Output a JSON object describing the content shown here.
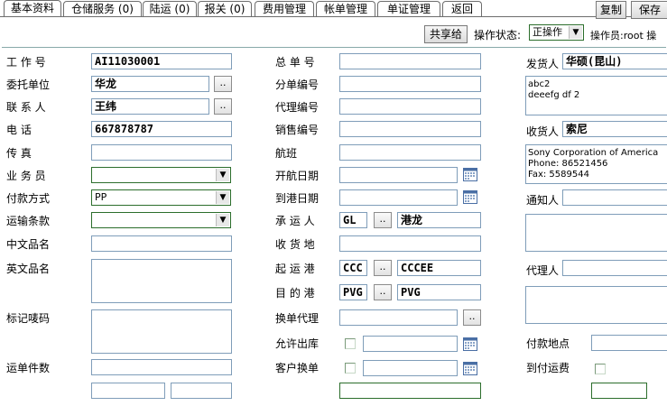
{
  "tabs": [
    "基本资料",
    "仓储服务 (0)",
    "陆运 (0)",
    "报关 (0)",
    "费用管理",
    "帐单管理",
    "单证管理",
    "返回"
  ],
  "top_buttons": {
    "copy": "复制",
    "save": "保存"
  },
  "toolbar": {
    "share": "共享给",
    "status_label": "操作状态:",
    "status_value": "正操作",
    "operator": "操作员:root 操"
  },
  "left": {
    "job_no_label": "工 作 号",
    "job_no": "AI11030001",
    "client_label": "委托单位",
    "client": "华龙",
    "contact_label": "联 系 人",
    "contact": "王纬",
    "phone_label": "电 话",
    "phone": "667878787",
    "fax_label": "传 真",
    "fax": "",
    "sales_label": "业 务 员",
    "sales": "",
    "payment_label": "付款方式",
    "payment": "PP",
    "terms_label": "运输条款",
    "terms": "",
    "cn_name_label": "中文品名",
    "cn_name": "",
    "en_name_label": "英文品名",
    "marks_label": "标记唛码",
    "pieces_label": "运单件数"
  },
  "middle": {
    "master_label": "总 单 号",
    "sub_label": "分单编号",
    "agent_no_label": "代理编号",
    "sales_no_label": "销售编号",
    "flight_label": "航班",
    "depart_label": "开航日期",
    "arrive_label": "到港日期",
    "carrier_label": "承 运 人",
    "carrier_code": "GL",
    "carrier_name": "港龙",
    "receive_label": "收 货 地",
    "origin_label": "起 运 港",
    "origin_code": "CCC",
    "origin_name": "CCCEE",
    "dest_label": "目 的 港",
    "dest_code": "PVG",
    "dest_name": "PVG",
    "exchange_agent_label": "换单代理",
    "allow_out_label": "允许出库",
    "client_exchange_label": "客户换单"
  },
  "right": {
    "shipper_label": "发货人",
    "shipper": "华硕(昆山)",
    "shipper_addr_1": "abc2",
    "shipper_addr_2": "deeefg df 2",
    "consignee_label": "收货人",
    "consignee": "索尼",
    "consignee_addr_1": "Sony Corporation of America",
    "consignee_addr_2": "Phone:  86521456",
    "consignee_addr_3": "Fax:  5589544",
    "notify_label": "通知人",
    "agent_label": "代理人",
    "pay_place_label": "付款地点",
    "collect_label": "到付运费"
  },
  "dots": ".."
}
